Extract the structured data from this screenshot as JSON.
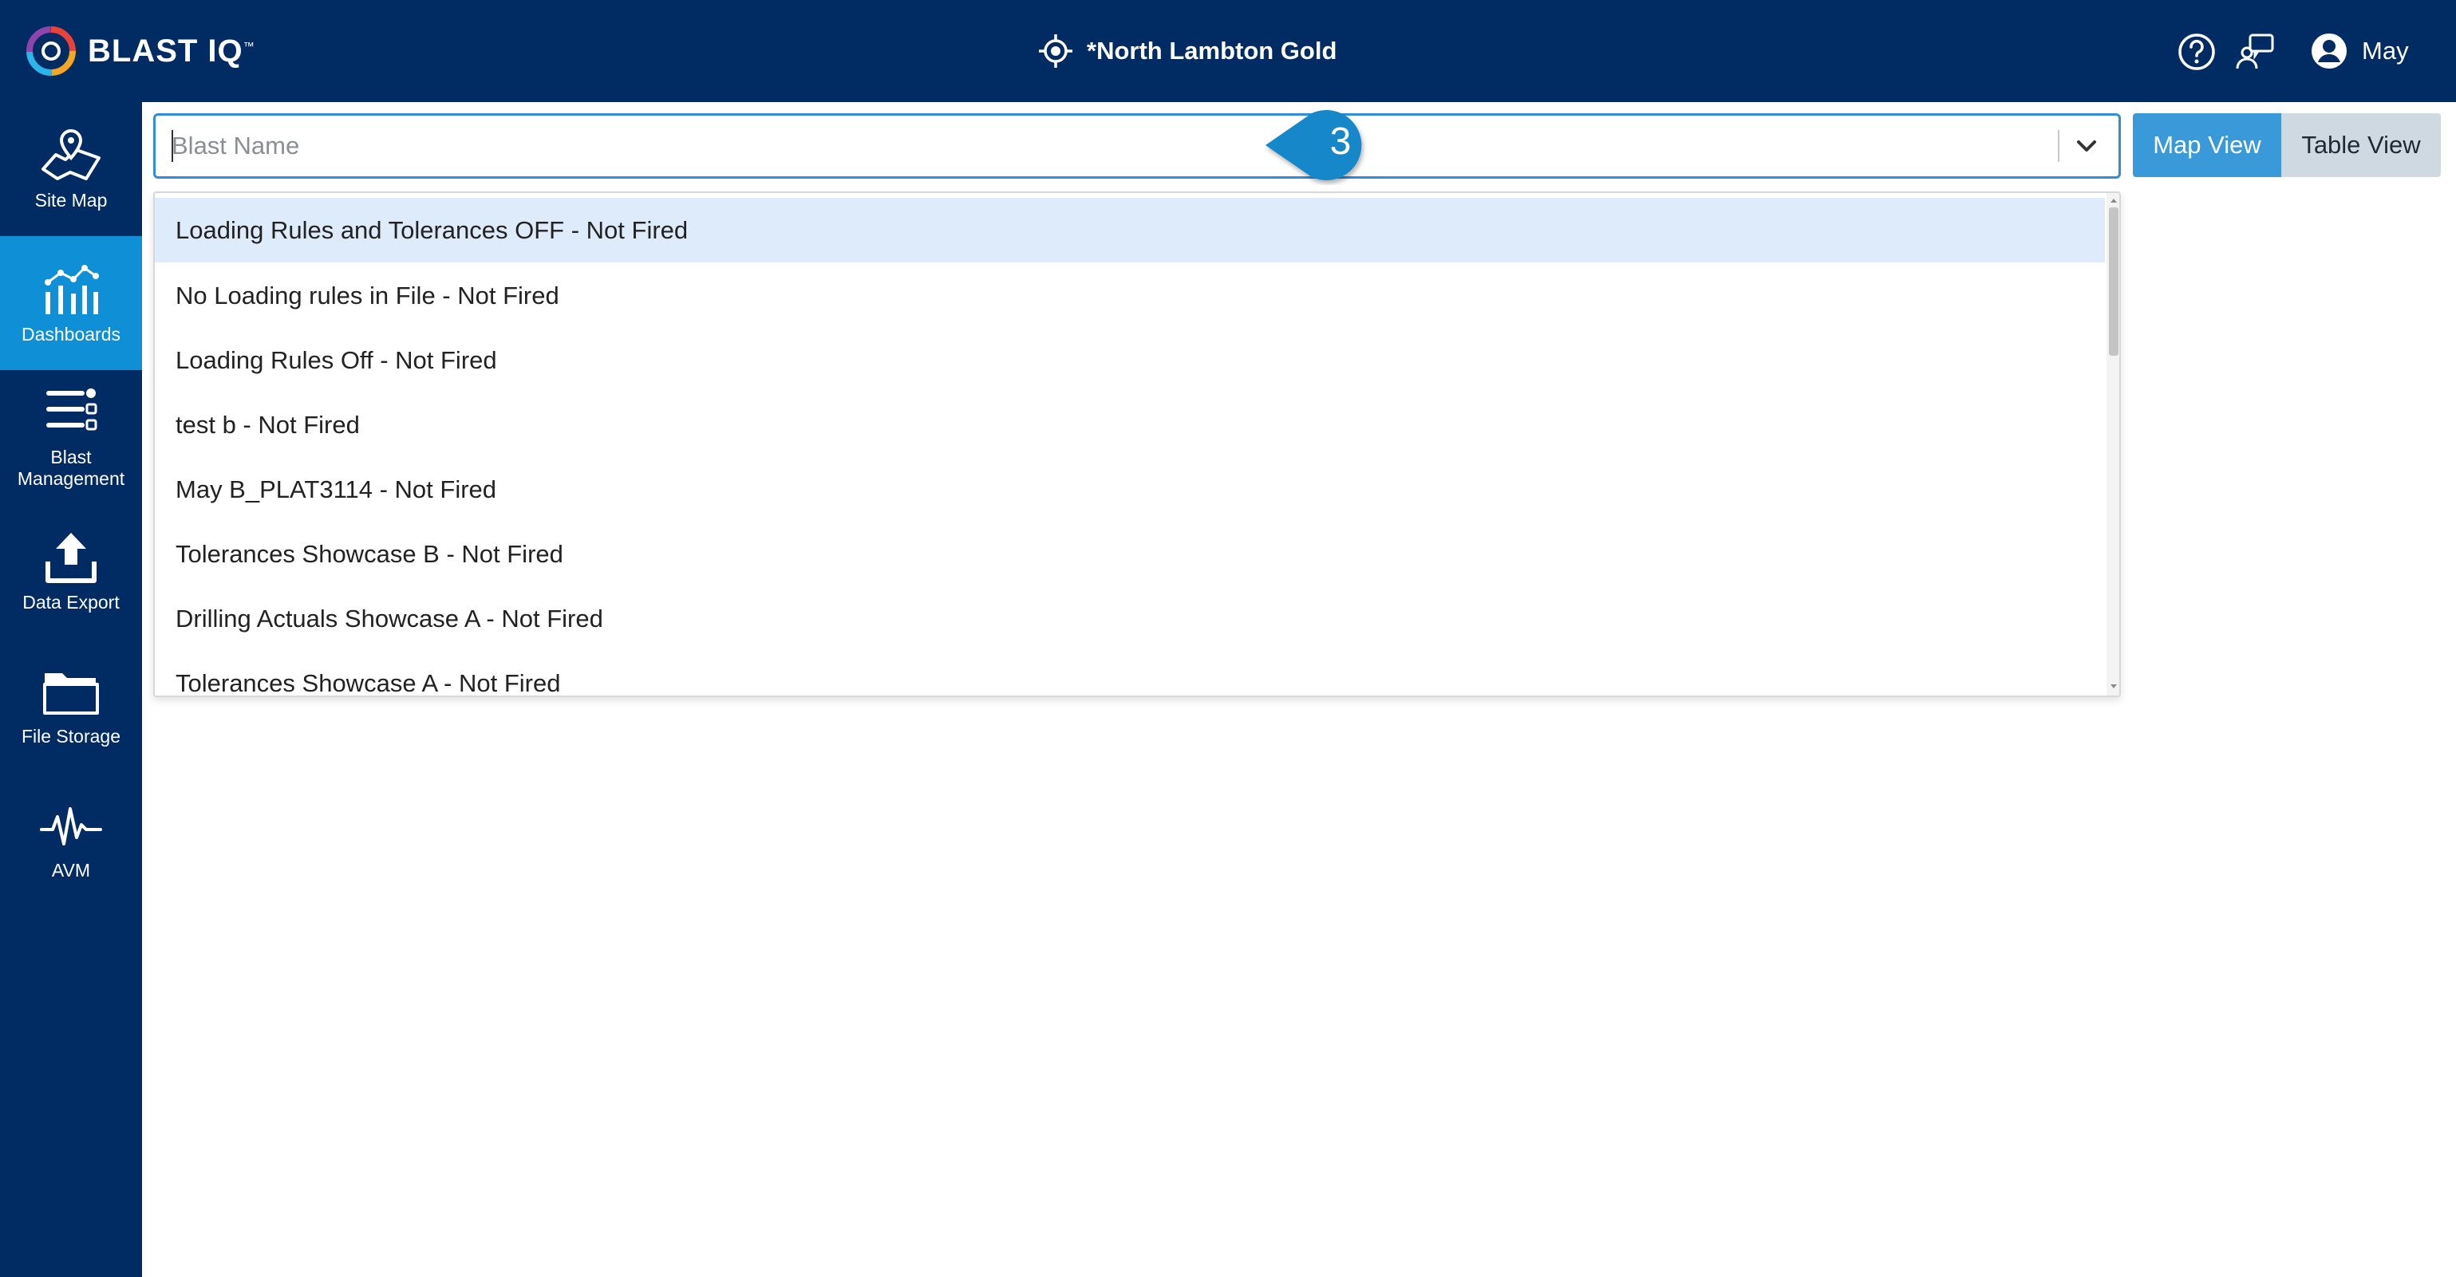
{
  "header": {
    "logo_text": "BLAST IQ",
    "logo_tm": "™",
    "site_name": "*North Lambton Gold",
    "user_name": "May"
  },
  "sidebar": {
    "items": [
      {
        "label": "Site Map",
        "icon": "map-pin-icon",
        "active": false
      },
      {
        "label": "Dashboards",
        "icon": "dashboard-chart-icon",
        "active": true
      },
      {
        "label": "Blast Management",
        "icon": "blast-management-icon",
        "active": false
      },
      {
        "label": "Data Export",
        "icon": "upload-icon",
        "active": false
      },
      {
        "label": "File Storage",
        "icon": "folder-icon",
        "active": false
      },
      {
        "label": "AVM",
        "icon": "waveform-icon",
        "active": false
      }
    ]
  },
  "search": {
    "placeholder": "Blast Name",
    "value": ""
  },
  "callout": {
    "number": "3"
  },
  "view_toggle": {
    "map_label": "Map View",
    "table_label": "Table View",
    "selected": "Map View"
  },
  "dropdown": {
    "options": [
      "Loading Rules and Tolerances OFF - Not Fired",
      "No Loading rules in File - Not Fired",
      "Loading Rules Off - Not Fired",
      "test b - Not Fired",
      "May B_PLAT3114 - Not Fired",
      "Tolerances Showcase B - Not Fired",
      "Drilling Actuals Showcase A - Not Fired",
      "Tolerances Showcase A - Not Fired"
    ],
    "highlighted_index": 0
  },
  "colors": {
    "navy": "#002b63",
    "active_nav": "#0f8fd6",
    "accent_blue": "#3a9ad9",
    "highlight": "#deebfb"
  }
}
